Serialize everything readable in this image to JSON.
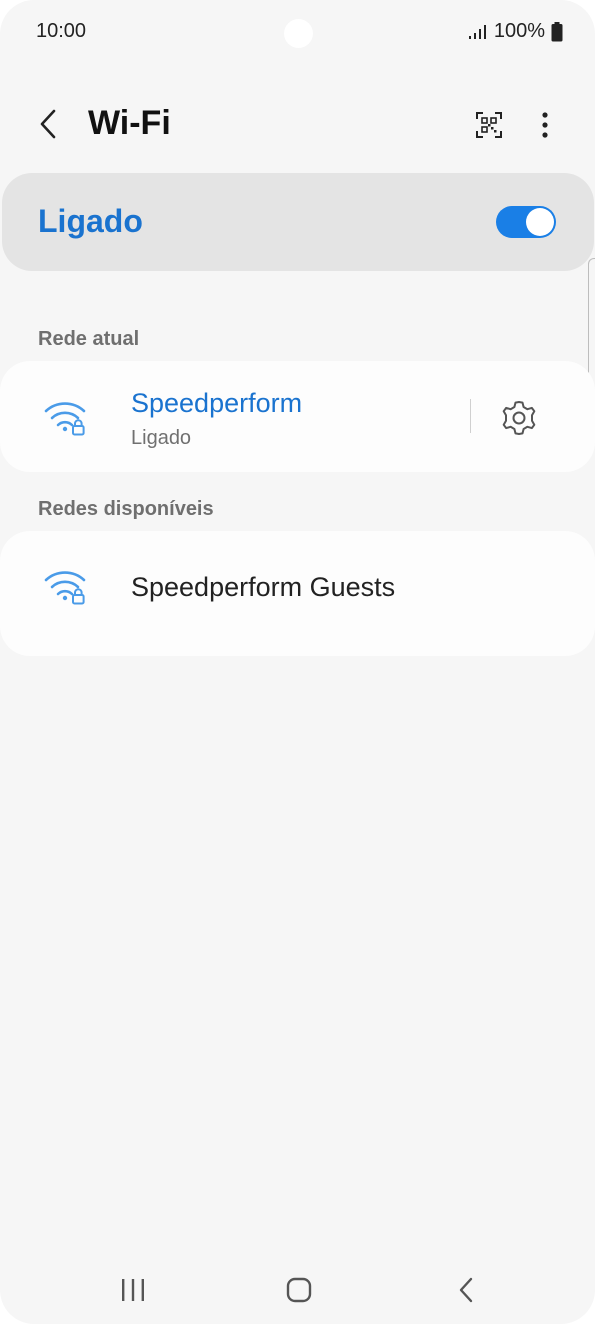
{
  "status_bar": {
    "time": "10:00",
    "battery": "100%",
    "icons": [
      "signal-icon",
      "battery-icon"
    ]
  },
  "header": {
    "title": "Wi-Fi",
    "back_icon": "back-chevron-icon",
    "qr_icon": "qr-code-scanner-icon",
    "more_icon": "more-vertical-icon"
  },
  "wifi_toggle": {
    "label": "Ligado",
    "enabled": true,
    "accent": "#1a73cf"
  },
  "current_network": {
    "section_title": "Rede atual",
    "name": "Speedperform",
    "status": "Ligado",
    "icon": "wifi-lock-icon",
    "settings_icon": "gear-icon"
  },
  "available_networks": {
    "section_title": "Redes disponíveis",
    "items": [
      {
        "name": "Speedperform Guests",
        "icon": "wifi-lock-icon"
      }
    ]
  },
  "nav_bar": {
    "icons": [
      "recent-apps-icon",
      "home-icon",
      "back-icon"
    ]
  }
}
